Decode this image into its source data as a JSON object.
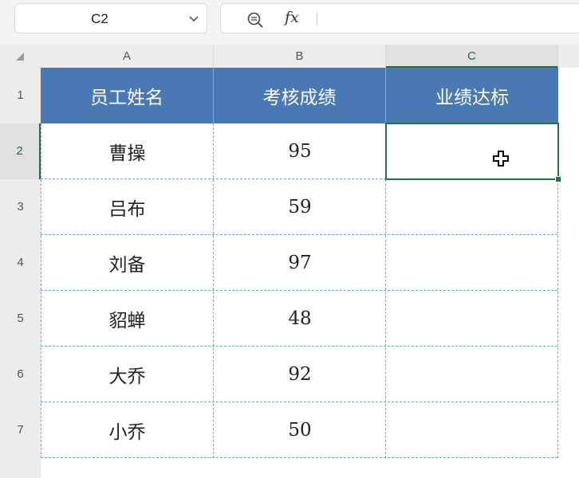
{
  "name_box": {
    "value": "C2"
  },
  "formula_bar": {
    "fx_label": "fx",
    "value": ""
  },
  "columns": [
    "A",
    "B",
    "C"
  ],
  "rows": [
    "1",
    "2",
    "3",
    "4",
    "5",
    "6",
    "7"
  ],
  "active_cell": {
    "column": "C",
    "row": "2"
  },
  "table": {
    "headers": [
      "员工姓名",
      "考核成绩",
      "业绩达标"
    ],
    "data": [
      [
        "曹操",
        "95",
        ""
      ],
      [
        "吕布",
        "59",
        ""
      ],
      [
        "刘备",
        "97",
        ""
      ],
      [
        "貂蝉",
        "48",
        ""
      ],
      [
        "大乔",
        "92",
        ""
      ],
      [
        "小乔",
        "50",
        ""
      ]
    ]
  },
  "colors": {
    "header_fill": "#4a78b3",
    "selection": "#217346",
    "gridline": "#7b9fc7"
  },
  "icons": {
    "zoom": "zoom-out-icon",
    "dropdown": "chevron-down-icon",
    "cursor": "cell-select-cursor-icon"
  }
}
